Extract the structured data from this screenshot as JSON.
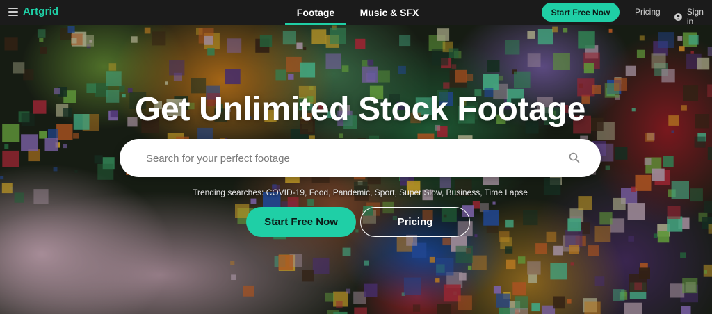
{
  "nav": {
    "logo": "Artgrid",
    "tabs": [
      {
        "label": "Footage",
        "active": true
      },
      {
        "label": "Music & SFX",
        "active": false
      }
    ],
    "cta": "Start Free Now",
    "pricing": "Pricing",
    "signin": "Sign in",
    "icons": [
      "hamburger-menu-icon",
      "user-icon"
    ]
  },
  "hero": {
    "headline": "Get Unlimited Stock Footage",
    "search": {
      "placeholder": "Search for your perfect footage",
      "icon": "search-icon"
    },
    "trending": {
      "prefix": "Trending searches: ",
      "terms": [
        "COVID-19",
        "Food",
        "Pandemic",
        "Sport",
        "Super Slow",
        "Business",
        "Time Lapse"
      ]
    },
    "primary_button": "Start Free Now",
    "secondary_button": "Pricing"
  },
  "colors": {
    "accent": "#1fcfa6",
    "nav_bg": "#1b1b1b",
    "text_light": "#ffffff"
  }
}
